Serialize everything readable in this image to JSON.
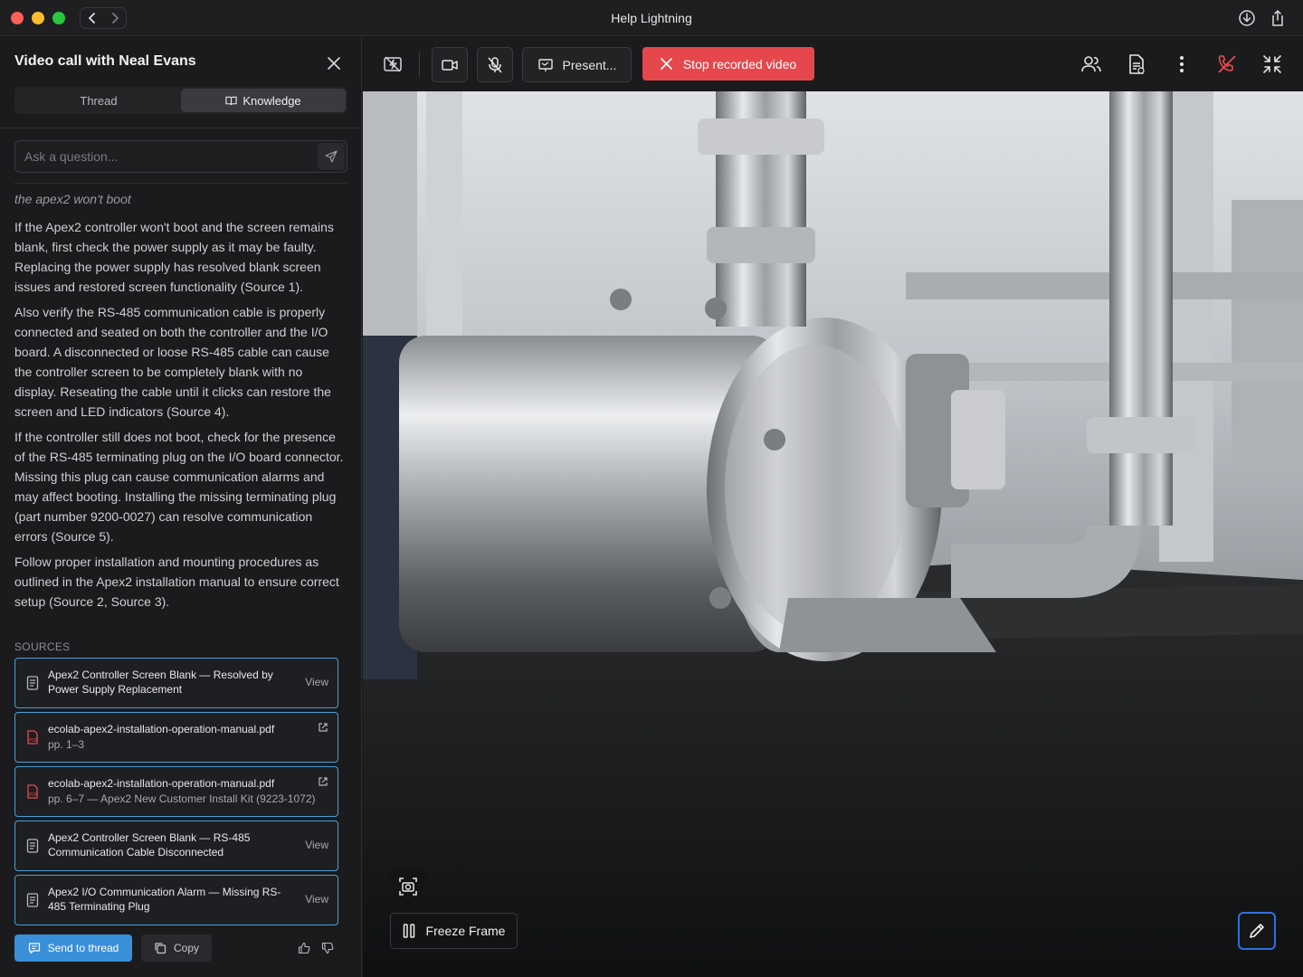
{
  "window": {
    "title": "Help Lightning"
  },
  "panel": {
    "title": "Video call with Neal Evans",
    "tabs": [
      {
        "label": "Thread",
        "active": false
      },
      {
        "label": "Knowledge",
        "active": true
      }
    ],
    "ask_placeholder": "Ask a question...",
    "query": "the apex2 won't boot",
    "answer": [
      "If the Apex2 controller won't boot and the screen remains blank, first check the power supply as it may be faulty. Replacing the power supply has resolved blank screen issues and restored screen functionality (Source 1).",
      "Also verify the RS-485 communication cable is properly connected and seated on both the controller and the I/O board. A disconnected or loose RS-485 cable can cause the controller screen to be completely blank with no display. Reseating the cable until it clicks can restore the screen and LED indicators (Source 4).",
      "If the controller still does not boot, check for the presence of the RS-485 terminating plug on the I/O board connector. Missing this plug can cause communication alarms and may affect booting. Installing the missing terminating plug (part number 9200-0027) can resolve communication errors (Source 5).",
      "Follow proper installation and mounting procedures as outlined in the Apex2 installation manual to ensure correct setup (Source 2, Source 3)."
    ],
    "sources_label": "SOURCES",
    "sources": [
      {
        "type": "article",
        "title": "Apex2 Controller Screen Blank — Resolved by Power Supply Replacement",
        "subtitle": "",
        "action": "View"
      },
      {
        "type": "pdf",
        "title": "ecolab-apex2-installation-operation-manual.pdf",
        "subtitle": "pp. 1–3",
        "action": ""
      },
      {
        "type": "pdf",
        "title": "ecolab-apex2-installation-operation-manual.pdf",
        "subtitle": "pp. 6–7   — Apex2 New Customer Install Kit (9223-1072)",
        "action": ""
      },
      {
        "type": "article",
        "title": "Apex2 Controller Screen Blank — RS-485 Communication Cable Disconnected",
        "subtitle": "",
        "action": "View"
      },
      {
        "type": "article",
        "title": "Apex2 I/O Communication Alarm — Missing RS-485 Terminating Plug",
        "subtitle": "",
        "action": "View"
      }
    ],
    "send_label": "Send to thread",
    "copy_label": "Copy"
  },
  "toolbar": {
    "present_label": "Present...",
    "stop_label": "Stop recorded video",
    "icons": [
      "flash-off-icon",
      "camera-icon",
      "mic-off-icon",
      "present-icon",
      "participants-icon",
      "notes-icon",
      "more-icon",
      "end-call-icon",
      "collapse-icon"
    ]
  },
  "video": {
    "freeze_label": "Freeze Frame"
  },
  "colors": {
    "accent_blue": "#3a8fd9",
    "stop_red": "#e5474d",
    "source_border": "#4a9fd6"
  }
}
